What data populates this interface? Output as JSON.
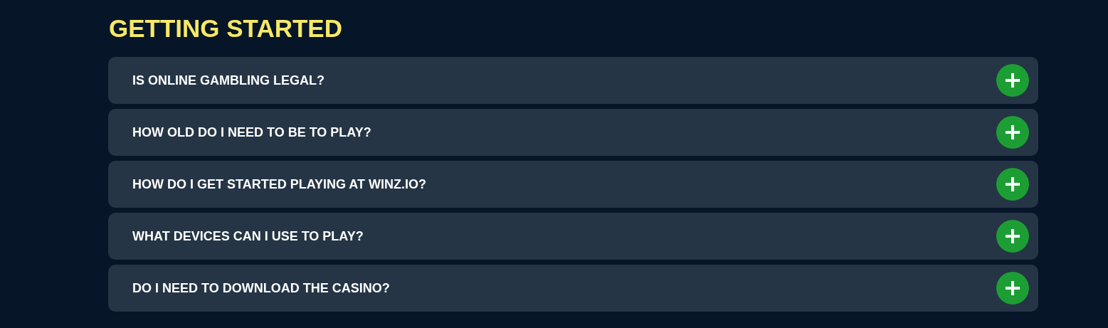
{
  "title": "GETTING STARTED",
  "faq": [
    {
      "question": "IS ONLINE GAMBLING LEGAL?",
      "expanded": false
    },
    {
      "question": "HOW OLD DO I NEED TO BE TO PLAY?",
      "expanded": false
    },
    {
      "question": "HOW DO I GET STARTED PLAYING AT WINZ.IO?",
      "expanded": false
    },
    {
      "question": "WHAT DEVICES CAN I USE TO PLAY?",
      "expanded": false
    },
    {
      "question": "DO I NEED TO DOWNLOAD THE CASINO?",
      "expanded": false
    }
  ]
}
